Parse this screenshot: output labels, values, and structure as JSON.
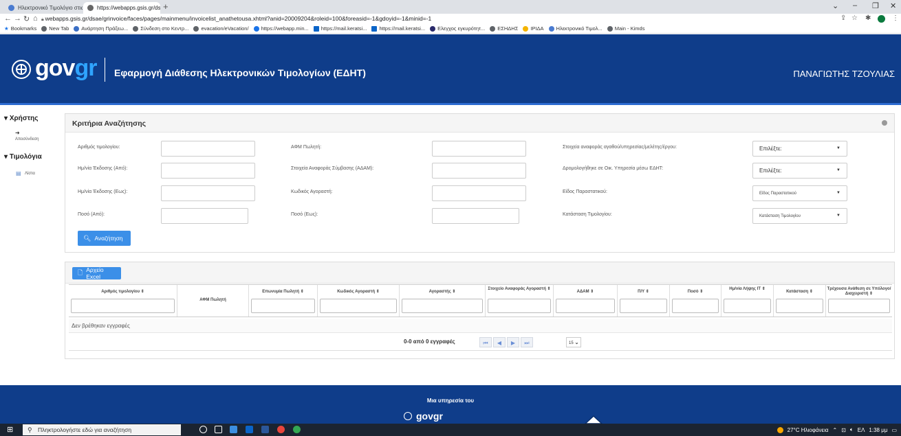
{
  "browser": {
    "tabs": [
      {
        "label": "Ηλεκτρονικό Τιμολόγιο στις Δημ",
        "active": false
      },
      {
        "label": "https://webapps.gsis.gr/dsae/gri",
        "active": true
      }
    ],
    "url": "webapps.gsis.gr/dsae/grinvoice/faces/pages/mainmenu/invoicelist_anathetousa.xhtml?anid=20009204&roleid=100&foreasid=-1&gdoyid=-1&minid=-1",
    "bookmarks": [
      "Bookmarks",
      "New Tab",
      "Ανάρτηση Πράξεω...",
      "Σύνδεση στο Κεντρ...",
      "evacation/eVacation/",
      "https://webapp.min...",
      "https://mail.keratsi...",
      "https://mail.keratsi...",
      "Ελεγχος εγκυρότητ...",
      "ΕΣΗΔΗΣ",
      "ΙΡΙΔΑ",
      "Ηλεκτρονικό Τιμολ...",
      "Main - Kimds"
    ]
  },
  "header": {
    "logo": "gov",
    "logo_accent": "gr",
    "app_title": "Εφαρμογή Διάθεσης Ηλεκτρονικών Τιμολογίων (ΕΔΗΤ)",
    "user_name": "ΠΑΝΑΓΙΩΤΗΣ ΤΖΟΥΛΙΑΣ"
  },
  "sidebar": {
    "user_section": "Χρήστης",
    "logout": "Αποσύνδεση",
    "invoices_section": "Τιμολόγια",
    "list": "Λίστα"
  },
  "search": {
    "title": "Κριτήρια Αναζήτησης",
    "labels": {
      "invoice_no": "Αριθμός τιμολογίου:",
      "issue_from": "Ημ/νία Έκδοσης (Από):",
      "issue_to": "Ημ/νία Έκδοσης (Εως):",
      "amount_from": "Ποσό (Από):",
      "seller_afm": "ΑΦΜ Πωλητή:",
      "contract_ref": "Στοιχεία Αναφοράς Σύμβασης (ΑΔΑΜ):",
      "buyer_code": "Κωδικός Αγοραστή:",
      "amount_to": "Ποσό (Εως):",
      "item_ref": "Στοιχεία αναφοράς αγαθού/υπηρεσίας/μελέτης/έργου:",
      "routed": "Δρομολογήθηκε σε Οικ. Υπηρεσία μέσω ΕΔΗΤ:",
      "doc_type": "Είδος Παραστατικού:",
      "status": "Κατάσταση Τιμολογίου:"
    },
    "selects": {
      "item_ref": "Επιλέξτε:",
      "routed": "Επιλέξτε:",
      "doc_type": "Είδος Παραστατικού",
      "status": "Κατάσταση Τιμολογίου"
    },
    "search_button": "Αναζήτηση"
  },
  "results": {
    "excel_button": "Αρχείο Excel",
    "columns": [
      "Αριθμός τιμολογίου ⇕",
      "ΑΦΜ Πωλητή",
      "Επωνυμία Πωλητή ⇕",
      "Κωδικός Αγοραστή ⇕",
      "Αγοραστής ⇕",
      "Στοιχείο Αναφοράς Αγοραστή ⇕",
      "ΑΔΑΜ ⇕",
      "Π/Υ ⇕",
      "Ποσό ⇕",
      "Ημ/νία Λήψης ΙΤ ⇕",
      "Κατάσταση ⇕",
      "Τρέχουσα Ανάθεση σε Υπόλογο/Διαχειριστή ⇕"
    ],
    "empty_message": "Δεν βρέθηκαν εγγραφές",
    "pager_text": "0-0 από 0 εγγραφές",
    "rows_per_page": "15"
  },
  "footer": {
    "label": "Μια υπηρεσία του",
    "logo": "govgr"
  },
  "taskbar": {
    "search_placeholder": "Πληκτρολογήστε εδώ για αναζήτηση",
    "weather": "27°C Ηλιοφάνεια",
    "lang": "ΕΛ",
    "time": "1:38 μμ"
  }
}
